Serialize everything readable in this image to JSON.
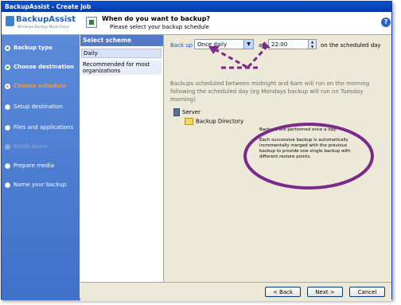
{
  "window": {
    "title": "BackupAssist - Create job"
  },
  "logo": {
    "brand": "BackupAssist",
    "tagline": "Windows Backup Made Easy!"
  },
  "header": {
    "title": "When do you want to backup?",
    "subtitle": "Please select your backup schedule"
  },
  "steps": [
    {
      "label": "Backup type",
      "state": "done"
    },
    {
      "label": "Choose destination",
      "state": "done"
    },
    {
      "label": "Choose schedule",
      "state": "current"
    },
    {
      "label": "Setup destination",
      "state": "todo"
    },
    {
      "label": "Files and applications",
      "state": "todo"
    },
    {
      "label": "Notifications",
      "state": "disabled"
    },
    {
      "label": "Prepare media",
      "state": "todo"
    },
    {
      "label": "Name your backup",
      "state": "todo"
    }
  ],
  "scheme": {
    "heading": "Select scheme",
    "items": [
      "Daily",
      "Recommended for most organizations"
    ]
  },
  "schedule": {
    "backup_up_label": "Back up",
    "frequency": "Once daily",
    "at_label": "at:",
    "time": "22:00",
    "on_scheduled_day": "on the scheduled day",
    "note": "Backups scheduled between midnight and 6am will run on the morning following the scheduled day (eg Mondays backup will run on Tuesday morning)"
  },
  "tree": {
    "server": "Server",
    "directory": "Backup Directory"
  },
  "info": {
    "line1": "Backups are performed once a day.",
    "line2": "Each successive backup is automatically incrementally merged with the previous backup to provide one single backup with different restore points."
  },
  "footer": {
    "back": "< Back",
    "next": "Next >",
    "cancel": "Cancel"
  },
  "colors": {
    "accent": "#7a2a8a",
    "sidebar": "#4d7fd4",
    "current_step": "#f89d2b"
  }
}
